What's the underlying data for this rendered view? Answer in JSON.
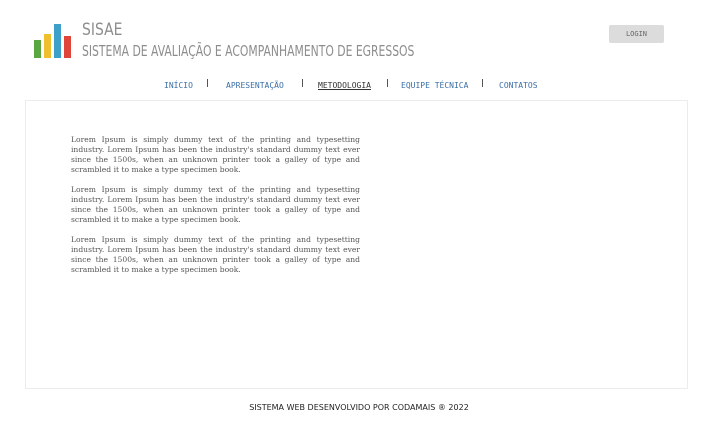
{
  "brand": {
    "title": "SISAE",
    "subtitle": "SISTEMA DE AVALIAÇÃO E ACOMPANHAMENTO DE EGRESSOS",
    "logo_colors": [
      "#5aa640",
      "#f0bf2e",
      "#3ca0c8",
      "#e0453a"
    ]
  },
  "header": {
    "login_label": "LOGIN"
  },
  "nav": {
    "items": [
      {
        "label": "INÍCIO"
      },
      {
        "label": "APRESENTAÇÃO"
      },
      {
        "label": "METODOLOGIA",
        "active": true
      },
      {
        "label": "EQUIPE TÉCNICA"
      },
      {
        "label": "CONTATOS"
      }
    ],
    "link_color": "#3a6fa8"
  },
  "content": {
    "paragraphs": [
      "Lorem Ipsum is simply dummy text of the printing and typesetting industry. Lorem Ipsum has been the industry's standard dummy text ever since the 1500s, when an unknown printer took a galley of type and scrambled it to make a type specimen book.",
      "Lorem Ipsum is simply dummy text of the printing and typesetting industry. Lorem Ipsum has been the industry's standard dummy text ever since the 1500s, when an unknown printer took a galley of type and scrambled it to make a type specimen book.",
      "Lorem Ipsum is simply dummy text of the printing and typesetting industry. Lorem Ipsum has been the industry's standard dummy text ever since the 1500s, when an unknown printer took a galley of type and scrambled it to make a type specimen book."
    ]
  },
  "footer": {
    "text": "SISTEMA WEB DESENVOLVIDO POR CODAMAIS ® 2022"
  }
}
